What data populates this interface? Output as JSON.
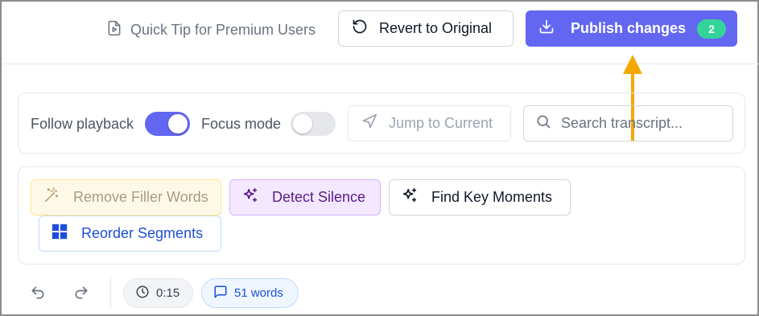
{
  "header": {
    "tip_label": "Quick Tip for Premium Users",
    "revert_label": "Revert to Original",
    "publish_label": "Publish changes",
    "publish_badge": "2"
  },
  "playback": {
    "follow_label": "Follow playback",
    "follow_on": true,
    "focus_label": "Focus mode",
    "focus_on": false,
    "jump_label": "Jump to Current",
    "search_placeholder": "Search transcript...",
    "search_value": ""
  },
  "tools": {
    "filler_label": "Remove Filler Words",
    "silence_label": "Detect Silence",
    "moments_label": "Find Key Moments",
    "reorder_label": "Reorder Segments"
  },
  "footer": {
    "duration": "0:15",
    "word_count": "51 words"
  },
  "icons": {
    "tip": "file-play-icon",
    "revert": "rotate-ccw-icon",
    "publish": "download-icon",
    "jump": "navigation-icon",
    "search": "search-icon",
    "filler": "magic-wand-icon",
    "silence": "sparkles-icon",
    "moments": "sparkles-icon",
    "reorder": "grid-icon",
    "undo": "undo-icon",
    "redo": "redo-icon",
    "clock": "clock-icon",
    "words": "message-icon"
  },
  "colors": {
    "accent": "#6366f1",
    "badge": "#34d399",
    "arrow": "#f5a800"
  }
}
